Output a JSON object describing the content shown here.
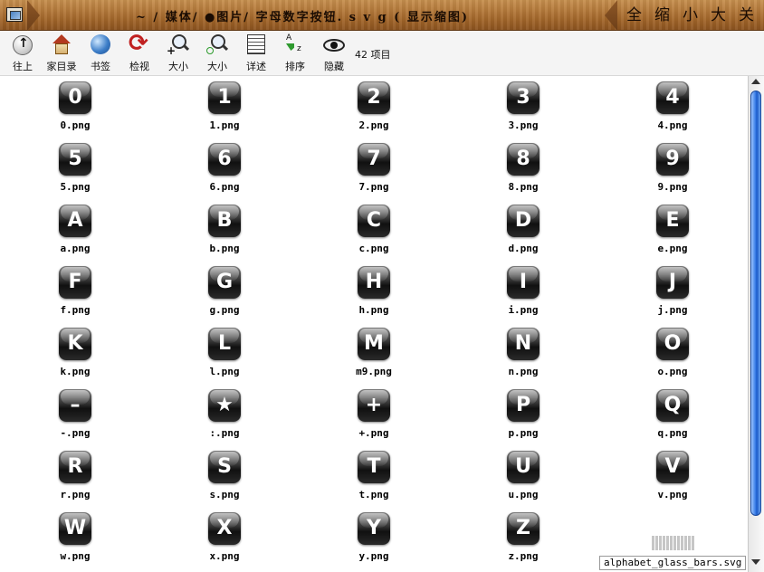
{
  "window": {
    "title": "~ / 媒体/ ●图片/ 字母数字按钮. s v g  ( 显示缩图)",
    "buttons": [
      "全",
      "缩",
      "小",
      "大",
      "关"
    ]
  },
  "toolbar": {
    "buttons": [
      {
        "label": "往上",
        "icon": "up-arrow-icon"
      },
      {
        "label": "家目录",
        "icon": "home-icon"
      },
      {
        "label": "书签",
        "icon": "bookmark-globe-icon"
      },
      {
        "label": "检视",
        "icon": "reload-icon"
      },
      {
        "label": "大小",
        "icon": "zoom-in-icon"
      },
      {
        "label": "大小",
        "icon": "zoom-out-icon"
      },
      {
        "label": "详述",
        "icon": "details-icon"
      },
      {
        "label": "排序",
        "icon": "sort-icon"
      },
      {
        "label": "隐藏",
        "icon": "eye-icon"
      }
    ],
    "item_count": "42 项目"
  },
  "files": [
    {
      "glyph": "0",
      "name": "0.png"
    },
    {
      "glyph": "1",
      "name": "1.png"
    },
    {
      "glyph": "2",
      "name": "2.png"
    },
    {
      "glyph": "3",
      "name": "3.png"
    },
    {
      "glyph": "4",
      "name": "4.png"
    },
    {
      "glyph": "5",
      "name": "5.png"
    },
    {
      "glyph": "6",
      "name": "6.png"
    },
    {
      "glyph": "7",
      "name": "7.png"
    },
    {
      "glyph": "8",
      "name": "8.png"
    },
    {
      "glyph": "9",
      "name": "9.png"
    },
    {
      "glyph": "A",
      "name": "a.png"
    },
    {
      "glyph": "B",
      "name": "b.png"
    },
    {
      "glyph": "C",
      "name": "c.png"
    },
    {
      "glyph": "D",
      "name": "d.png"
    },
    {
      "glyph": "E",
      "name": "e.png"
    },
    {
      "glyph": "F",
      "name": "f.png"
    },
    {
      "glyph": "G",
      "name": "g.png"
    },
    {
      "glyph": "H",
      "name": "h.png"
    },
    {
      "glyph": "I",
      "name": "i.png"
    },
    {
      "glyph": "J",
      "name": "j.png"
    },
    {
      "glyph": "K",
      "name": "k.png"
    },
    {
      "glyph": "L",
      "name": "l.png"
    },
    {
      "glyph": "M",
      "name": "m9.png"
    },
    {
      "glyph": "N",
      "name": "n.png"
    },
    {
      "glyph": "O",
      "name": "o.png"
    },
    {
      "glyph": "–",
      "name": "-.png"
    },
    {
      "glyph": "★",
      "name": ":.png"
    },
    {
      "glyph": "+",
      "name": "+.png"
    },
    {
      "glyph": "P",
      "name": "p.png"
    },
    {
      "glyph": "Q",
      "name": "q.png"
    },
    {
      "glyph": "R",
      "name": "r.png"
    },
    {
      "glyph": "S",
      "name": "s.png"
    },
    {
      "glyph": "T",
      "name": "t.png"
    },
    {
      "glyph": "U",
      "name": "u.png"
    },
    {
      "glyph": "V",
      "name": "v.png"
    },
    {
      "glyph": "W",
      "name": "w.png"
    },
    {
      "glyph": "X",
      "name": "x.png"
    },
    {
      "glyph": "Y",
      "name": "y.png"
    },
    {
      "glyph": "Z",
      "name": "z.png"
    }
  ],
  "status": {
    "filename": "alphabet_glass_bars.svg"
  }
}
